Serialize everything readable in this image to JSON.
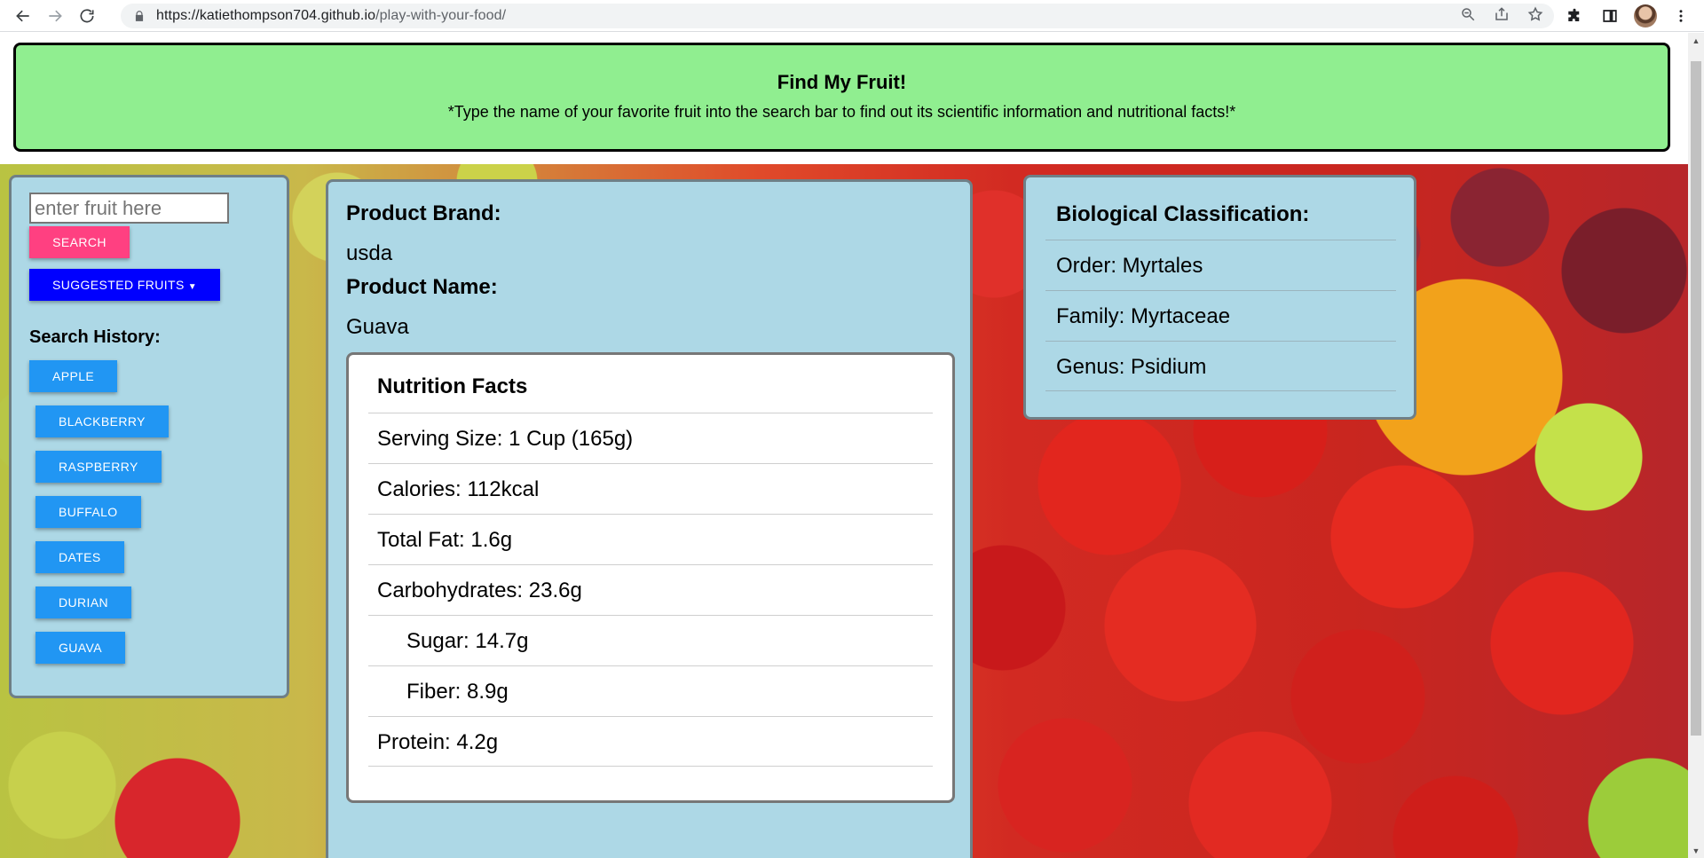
{
  "browser": {
    "url_host": "https://katiethompson704.github.io",
    "url_path": "/play-with-your-food/"
  },
  "header": {
    "title": "Find My Fruit!",
    "subtitle": "*Type the name of your favorite fruit into the search bar to find out its scientific information and nutritional facts!*"
  },
  "sidebar": {
    "search_placeholder": "enter fruit here",
    "search_button": "SEARCH",
    "suggest_button": "SUGGESTED FRUITS",
    "history_title": "Search History:",
    "history": [
      "APPLE",
      "BLACKBERRY",
      "RASPBERRY",
      "BUFFALO",
      "DATES",
      "DURIAN",
      "GUAVA"
    ]
  },
  "product": {
    "brand_label": "Product Brand:",
    "brand_value": "usda",
    "name_label": "Product Name:",
    "name_value": "Guava"
  },
  "nutrition": {
    "title": "Nutrition Facts",
    "rows": [
      "Serving Size: 1 Cup (165g)",
      "Calories: 112kcal",
      "Total Fat: 1.6g",
      "Carbohydrates: 23.6g",
      "Sugar: 14.7g",
      "Fiber: 8.9g",
      "Protein: 4.2g"
    ]
  },
  "classification": {
    "title": "Biological Classification:",
    "rows": [
      "Order: Myrtales",
      "Family: Myrtaceae",
      "Genus: Psidium"
    ]
  },
  "colors": {
    "header_bg": "#90ee90",
    "panel_bg": "#add8e6",
    "search_btn": "#ff4081",
    "suggest_btn": "#0000ff",
    "history_btn": "#2196f3"
  }
}
